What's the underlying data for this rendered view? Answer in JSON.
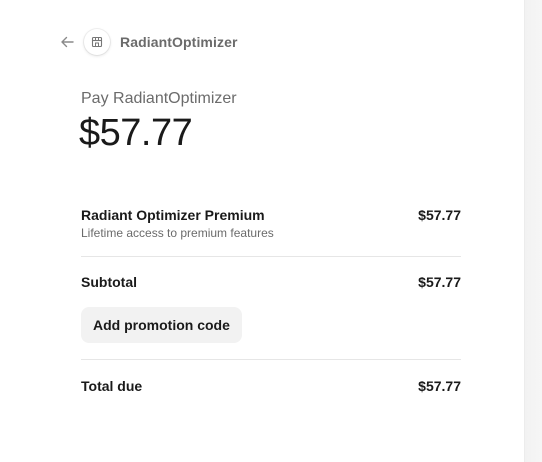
{
  "header": {
    "merchant_name": "RadiantOptimizer"
  },
  "summary": {
    "pay_label": "Pay RadiantOptimizer",
    "amount": "$57.77"
  },
  "line_items": [
    {
      "name": "Radiant Optimizer Premium",
      "description": "Lifetime access to premium features",
      "price": "$57.77"
    }
  ],
  "subtotal": {
    "label": "Subtotal",
    "value": "$57.77"
  },
  "promotion": {
    "button_label": "Add promotion code"
  },
  "total": {
    "label": "Total due",
    "value": "$57.77"
  },
  "icons": {
    "back": "arrow-left-icon",
    "merchant_logo": "store-icon"
  },
  "colors": {
    "text_primary": "#1a1a1a",
    "text_secondary": "#6b6b6b",
    "divider": "#e6e6e6",
    "button_bg": "#f2f2f2"
  }
}
